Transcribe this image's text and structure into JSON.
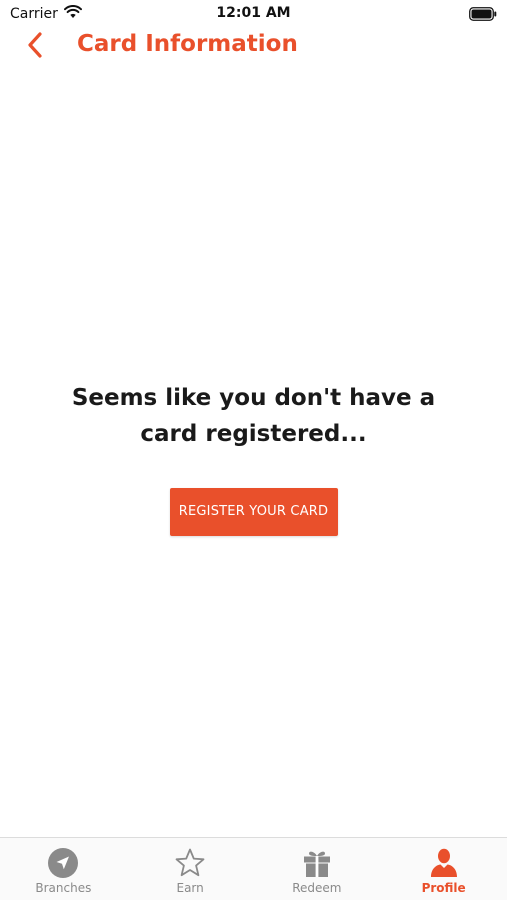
{
  "status_bar": {
    "carrier": "Carrier",
    "time": "12:01 AM"
  },
  "header": {
    "title": "Card Information",
    "back_icon": "chevron-left-icon"
  },
  "empty_state": {
    "message": "Seems like you don't have a card registered...",
    "button_label": "REGISTER YOUR CARD"
  },
  "tab_bar": {
    "tabs": [
      {
        "label": "Branches",
        "icon": "navigation-arrow-icon",
        "active": false
      },
      {
        "label": "Earn",
        "icon": "star-icon",
        "active": false
      },
      {
        "label": "Redeem",
        "icon": "gift-icon",
        "active": false
      },
      {
        "label": "Profile",
        "icon": "person-icon",
        "active": true
      }
    ]
  },
  "colors": {
    "accent": "#e9502b",
    "inactive": "#8a8a8a",
    "text": "#1a1a1a",
    "background": "#ffffff"
  }
}
